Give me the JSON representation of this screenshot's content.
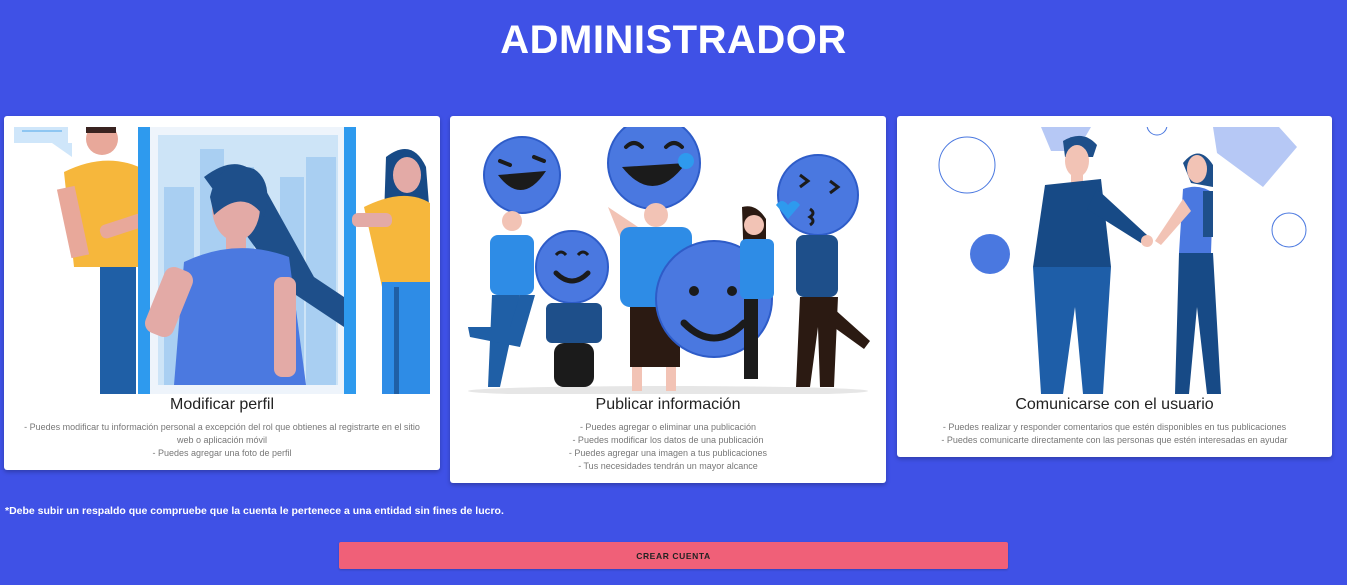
{
  "header": {
    "title": "ADMINISTRADOR"
  },
  "cards": [
    {
      "title": "Modificar perfil",
      "lines": [
        "- Puedes modificar tu información personal a excepción del rol que obtienes al registrarte en el sitio web o aplicación móvil",
        "- Puedes agregar una foto de perfil"
      ],
      "illustration": "profile-edit-illustration"
    },
    {
      "title": "Publicar información",
      "lines": [
        "- Puedes agregar o eliminar una publicación",
        "- Puedes modificar los datos de una publicación",
        "- Puedes agregar una imagen a tus publicaciones",
        "- Tus necesidades tendrán un mayor alcance"
      ],
      "illustration": "happy-emoji-crowd-illustration"
    },
    {
      "title": "Comunicarse con el usuario",
      "lines": [
        "- Puedes realizar y responder comentarios que estén disponibles en tus publicaciones",
        "- Puedes comunicarte directamente con las personas que estén interesadas en ayudar"
      ],
      "illustration": "handshake-illustration"
    }
  ],
  "footer": {
    "note": "*Debe subir un respaldo que compruebe que la cuenta le pertenece a una entidad sin fines de lucro.",
    "button_label": "CREAR CUENTA"
  },
  "colors": {
    "background": "#3f51e6",
    "button": "#f06078",
    "card": "#ffffff"
  }
}
